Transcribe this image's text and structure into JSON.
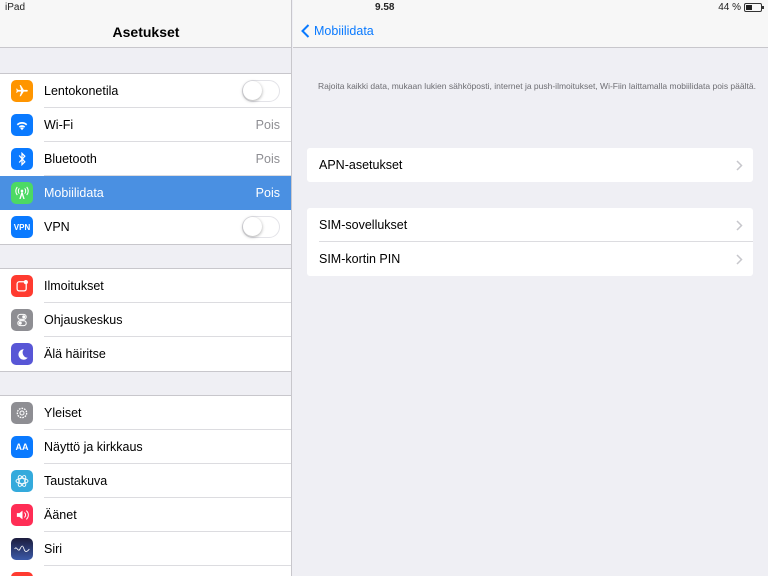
{
  "status_bar": {
    "device": "iPad",
    "time": "9.58",
    "battery": "44 %",
    "battery_level": 0.44
  },
  "master": {
    "title": "Asetukset",
    "groups": [
      {
        "items": [
          {
            "label": "Lentokonetila",
            "icon": "airplane-icon",
            "color": "#ff9500",
            "toggle": false
          },
          {
            "label": "Wi-Fi",
            "icon": "wifi-icon",
            "color": "#0a7aff",
            "value": "Pois"
          },
          {
            "label": "Bluetooth",
            "icon": "bluetooth-icon",
            "color": "#0a7aff",
            "value": "Pois"
          },
          {
            "label": "Mobiilidata",
            "icon": "cellular-icon",
            "color": "#4cd964",
            "value": "Pois",
            "selected": true
          },
          {
            "label": "VPN",
            "icon": "vpn-icon",
            "color": "#0a7aff",
            "icon_text": "VPN",
            "toggle": false
          }
        ]
      },
      {
        "items": [
          {
            "label": "Ilmoitukset",
            "icon": "notifications-icon",
            "color": "#ff3b30"
          },
          {
            "label": "Ohjauskeskus",
            "icon": "control-center-icon",
            "color": "#8e8e93"
          },
          {
            "label": "Älä häiritse",
            "icon": "moon-icon",
            "color": "#5856d6"
          }
        ]
      },
      {
        "items": [
          {
            "label": "Yleiset",
            "icon": "gear-icon",
            "color": "#8e8e93"
          },
          {
            "label": "Näyttö ja kirkkaus",
            "icon": "display-icon",
            "color": "#0a7aff",
            "icon_text": "AA"
          },
          {
            "label": "Taustakuva",
            "icon": "wallpaper-icon",
            "color": "#34aadc"
          },
          {
            "label": "Äänet",
            "icon": "sound-icon",
            "color": "#ff2d55"
          },
          {
            "label": "Siri",
            "icon": "siri-icon",
            "color": "#1c1c3c"
          }
        ]
      }
    ]
  },
  "detail": {
    "back_label": "Mobiilidata",
    "description": "Rajoita kaikki data, mukaan lukien sähköposti, internet ja push-ilmoitukset, Wi-Fiin laittamalla mobiilidata pois päältä.",
    "sections": [
      {
        "items": [
          {
            "label": "APN-asetukset"
          }
        ]
      },
      {
        "items": [
          {
            "label": "SIM-sovellukset"
          },
          {
            "label": "SIM-kortin PIN"
          }
        ]
      }
    ]
  },
  "colors": {
    "accent": "#0a7aff",
    "selected_row": "#4a90e2",
    "background": "#efeff4"
  }
}
